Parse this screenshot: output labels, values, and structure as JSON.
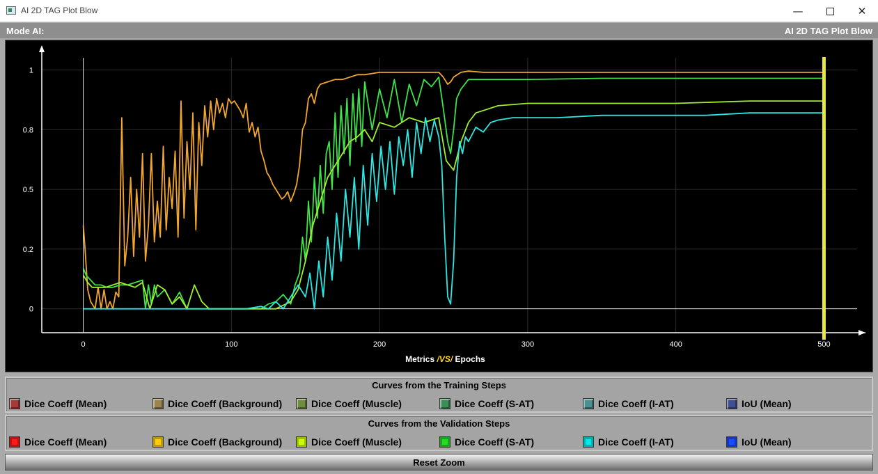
{
  "window": {
    "title": "AI 2D TAG Plot Blow",
    "minimize": "—",
    "close": "✕"
  },
  "header": {
    "mode_label": "Mode AI:",
    "plot_title": "AI 2D TAG Plot Blow"
  },
  "chart_data": {
    "type": "line",
    "title": "",
    "xlabel_parts": [
      "Metrics",
      "/VS/",
      "Epochs"
    ],
    "ylabel": "",
    "xlim": [
      -28,
      528
    ],
    "ylim": [
      -0.1,
      1.08
    ],
    "x_ticks": [
      0,
      100,
      200,
      300,
      400,
      500
    ],
    "y_ticks": [
      0,
      0.25,
      0.5,
      0.75,
      1
    ],
    "y_tick_labels": [
      "0",
      "0.2",
      "0.5",
      "0.8",
      "1"
    ],
    "grid": true,
    "cursor_x": 500,
    "series": [
      {
        "name": "Dice Coeff (Background)",
        "color": "#f2a62e",
        "x": [
          0,
          1,
          3,
          5,
          8,
          10,
          12,
          14,
          16,
          18,
          20,
          22,
          24,
          26,
          28,
          30,
          32,
          34,
          36,
          38,
          40,
          42,
          44,
          46,
          48,
          50,
          52,
          54,
          56,
          58,
          60,
          62,
          64,
          66,
          68,
          70,
          72,
          74,
          76,
          78,
          80,
          82,
          84,
          86,
          88,
          90,
          92,
          94,
          96,
          98,
          100,
          102,
          104,
          106,
          108,
          110,
          112,
          114,
          116,
          118,
          120,
          122,
          124,
          126,
          128,
          130,
          132,
          134,
          136,
          138,
          140,
          142,
          144,
          146,
          148,
          150,
          152,
          154,
          156,
          158,
          160,
          165,
          170,
          175,
          180,
          185,
          190,
          195,
          200,
          210,
          220,
          230,
          235,
          240,
          243,
          246,
          248,
          250,
          255,
          260,
          270,
          280,
          300,
          350,
          400,
          450,
          500
        ],
        "y": [
          0.35,
          0.27,
          0.08,
          0.03,
          0.0,
          0.09,
          0.0,
          0.08,
          0.0,
          0.03,
          0.0,
          0.07,
          0.05,
          0.8,
          0.18,
          0.3,
          0.55,
          0.22,
          0.5,
          0.3,
          0.65,
          0.2,
          0.35,
          0.65,
          0.28,
          0.45,
          0.3,
          0.68,
          0.33,
          0.55,
          0.42,
          0.66,
          0.3,
          0.87,
          0.38,
          0.7,
          0.5,
          0.82,
          0.33,
          0.78,
          0.6,
          0.85,
          0.72,
          0.87,
          0.75,
          0.88,
          0.82,
          0.86,
          0.8,
          0.88,
          0.86,
          0.87,
          0.85,
          0.83,
          0.8,
          0.86,
          0.74,
          0.78,
          0.72,
          0.76,
          0.66,
          0.62,
          0.57,
          0.55,
          0.52,
          0.5,
          0.48,
          0.46,
          0.47,
          0.49,
          0.45,
          0.48,
          0.52,
          0.6,
          0.75,
          0.78,
          0.88,
          0.9,
          0.86,
          0.92,
          0.94,
          0.95,
          0.96,
          0.96,
          0.97,
          0.98,
          0.98,
          0.985,
          0.99,
          0.99,
          0.99,
          0.99,
          0.99,
          0.99,
          0.97,
          0.94,
          0.95,
          0.97,
          0.99,
          0.995,
          0.99,
          0.99,
          0.99,
          0.99,
          0.99,
          0.99,
          0.99
        ]
      },
      {
        "name": "Dice Coeff (S-AT)",
        "color": "#3fe24a",
        "x": [
          0,
          2,
          5,
          8,
          12,
          16,
          20,
          25,
          30,
          35,
          40,
          42,
          44,
          46,
          48,
          50,
          55,
          60,
          65,
          70,
          75,
          80,
          85,
          90,
          100,
          110,
          120,
          125,
          130,
          135,
          140,
          143,
          146,
          148,
          150,
          152,
          154,
          156,
          158,
          160,
          162,
          164,
          166,
          168,
          170,
          172,
          174,
          176,
          178,
          180,
          182,
          184,
          186,
          188,
          190,
          195,
          200,
          205,
          210,
          215,
          220,
          225,
          230,
          235,
          240,
          243,
          246,
          248,
          250,
          252,
          255,
          260,
          270,
          280,
          300,
          350,
          400,
          450,
          500
        ],
        "y": [
          0.17,
          0.14,
          0.12,
          0.1,
          0.1,
          0.09,
          0.09,
          0.1,
          0.1,
          0.11,
          0.12,
          0.0,
          0.1,
          0.02,
          0.1,
          0.05,
          0.08,
          0.02,
          0.07,
          0.0,
          0.0,
          0.0,
          0.0,
          0.0,
          0.0,
          0.0,
          0.0,
          0.02,
          0.03,
          0.06,
          0.02,
          0.1,
          0.15,
          0.3,
          0.2,
          0.45,
          0.28,
          0.55,
          0.38,
          0.6,
          0.4,
          0.65,
          0.7,
          0.5,
          0.82,
          0.55,
          0.85,
          0.65,
          0.88,
          0.6,
          0.9,
          0.7,
          0.92,
          0.68,
          0.95,
          0.75,
          0.92,
          0.8,
          0.96,
          0.78,
          0.94,
          0.85,
          0.96,
          0.93,
          0.97,
          0.84,
          0.7,
          0.65,
          0.75,
          0.88,
          0.92,
          0.96,
          0.96,
          0.96,
          0.96,
          0.965,
          0.965,
          0.965,
          0.965
        ]
      },
      {
        "name": "Dice Coeff (Muscle)",
        "color": "#a0f02e",
        "x": [
          0,
          3,
          6,
          10,
          15,
          20,
          25,
          30,
          35,
          40,
          45,
          50,
          55,
          60,
          65,
          70,
          75,
          80,
          85,
          90,
          100,
          120,
          130,
          140,
          145,
          150,
          155,
          160,
          165,
          170,
          175,
          180,
          185,
          190,
          195,
          200,
          210,
          220,
          230,
          240,
          245,
          250,
          255,
          260,
          265,
          270,
          280,
          300,
          350,
          400,
          450,
          500
        ],
        "y": [
          0.14,
          0.11,
          0.09,
          0.09,
          0.09,
          0.1,
          0.11,
          0.1,
          0.09,
          0.11,
          0.0,
          0.1,
          0.08,
          0.02,
          0.05,
          0.0,
          0.1,
          0.03,
          0.0,
          0.0,
          0.0,
          0.0,
          0.0,
          0.03,
          0.08,
          0.2,
          0.35,
          0.45,
          0.55,
          0.6,
          0.65,
          0.7,
          0.72,
          0.75,
          0.7,
          0.78,
          0.76,
          0.8,
          0.78,
          0.8,
          0.62,
          0.58,
          0.7,
          0.78,
          0.82,
          0.83,
          0.85,
          0.86,
          0.86,
          0.86,
          0.87,
          0.87
        ]
      },
      {
        "name": "Dice Coeff (I-AT)",
        "color": "#2ee6e2",
        "x": [
          0,
          100,
          110,
          120,
          125,
          130,
          135,
          140,
          145,
          150,
          153,
          156,
          159,
          162,
          165,
          168,
          171,
          174,
          177,
          180,
          183,
          186,
          189,
          192,
          195,
          198,
          201,
          204,
          207,
          210,
          213,
          216,
          219,
          222,
          225,
          228,
          231,
          234,
          237,
          240,
          242,
          244,
          246,
          248,
          250,
          252,
          254,
          256,
          258,
          260,
          265,
          270,
          275,
          280,
          290,
          300,
          320,
          350,
          380,
          400,
          420,
          450,
          480,
          500
        ],
        "y": [
          0.0,
          0.0,
          0.0,
          0.01,
          0.0,
          0.03,
          0.0,
          0.05,
          0.1,
          0.05,
          0.15,
          0.0,
          0.2,
          0.05,
          0.3,
          0.12,
          0.4,
          0.2,
          0.5,
          0.3,
          0.55,
          0.25,
          0.6,
          0.35,
          0.65,
          0.45,
          0.68,
          0.5,
          0.7,
          0.48,
          0.72,
          0.6,
          0.75,
          0.55,
          0.78,
          0.65,
          0.8,
          0.7,
          0.79,
          0.72,
          0.6,
          0.3,
          0.05,
          0.02,
          0.2,
          0.55,
          0.7,
          0.65,
          0.72,
          0.7,
          0.76,
          0.74,
          0.78,
          0.79,
          0.8,
          0.8,
          0.8,
          0.81,
          0.81,
          0.81,
          0.81,
          0.82,
          0.82,
          0.82
        ]
      }
    ]
  },
  "legend_train": {
    "heading": "Curves from the Training Steps",
    "items": [
      {
        "label": "Dice Coeff (Mean)",
        "color": "#a33b3b"
      },
      {
        "label": "Dice Coeff (Background)",
        "color": "#9a8450"
      },
      {
        "label": "Dice Coeff (Muscle)",
        "color": "#6f8c3f"
      },
      {
        "label": "Dice Coeff (S-AT)",
        "color": "#3e8c57"
      },
      {
        "label": "Dice Coeff (I-AT)",
        "color": "#4b8f90"
      },
      {
        "label": "IoU (Mean)",
        "color": "#3f4f8f"
      }
    ]
  },
  "legend_val": {
    "heading": "Curves from the Validation Steps",
    "items": [
      {
        "label": "Dice Coeff (Mean)",
        "color": "#ff1a1a"
      },
      {
        "label": "Dice Coeff (Background)",
        "color": "#ffcc00"
      },
      {
        "label": "Dice Coeff (Muscle)",
        "color": "#ccff00"
      },
      {
        "label": "Dice Coeff (S-AT)",
        "color": "#22dd22"
      },
      {
        "label": "Dice Coeff (I-AT)",
        "color": "#00e8e8"
      },
      {
        "label": "IoU (Mean)",
        "color": "#1a4dff"
      }
    ]
  },
  "reset_button": {
    "label": "Reset Zoom"
  }
}
